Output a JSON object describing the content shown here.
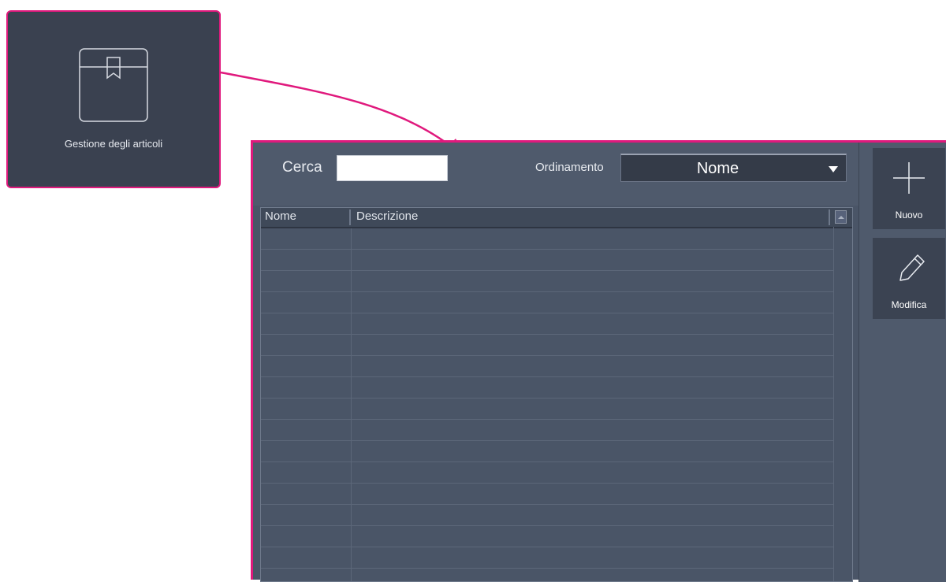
{
  "tile": {
    "label": "Gestione degli articoli",
    "icon": "box-icon"
  },
  "toolbar": {
    "search_label": "Cerca",
    "search_value": "",
    "sort_label": "Ordinamento",
    "sort_value": "Nome"
  },
  "grid": {
    "columns": [
      "Nome",
      "Descrizione"
    ],
    "rows": []
  },
  "side_panel": {
    "new_label": "Nuovo",
    "edit_label": "Modifica"
  },
  "colors": {
    "accent": "#e0197d",
    "panel": "#4a5567",
    "dark": "#3b4352"
  }
}
